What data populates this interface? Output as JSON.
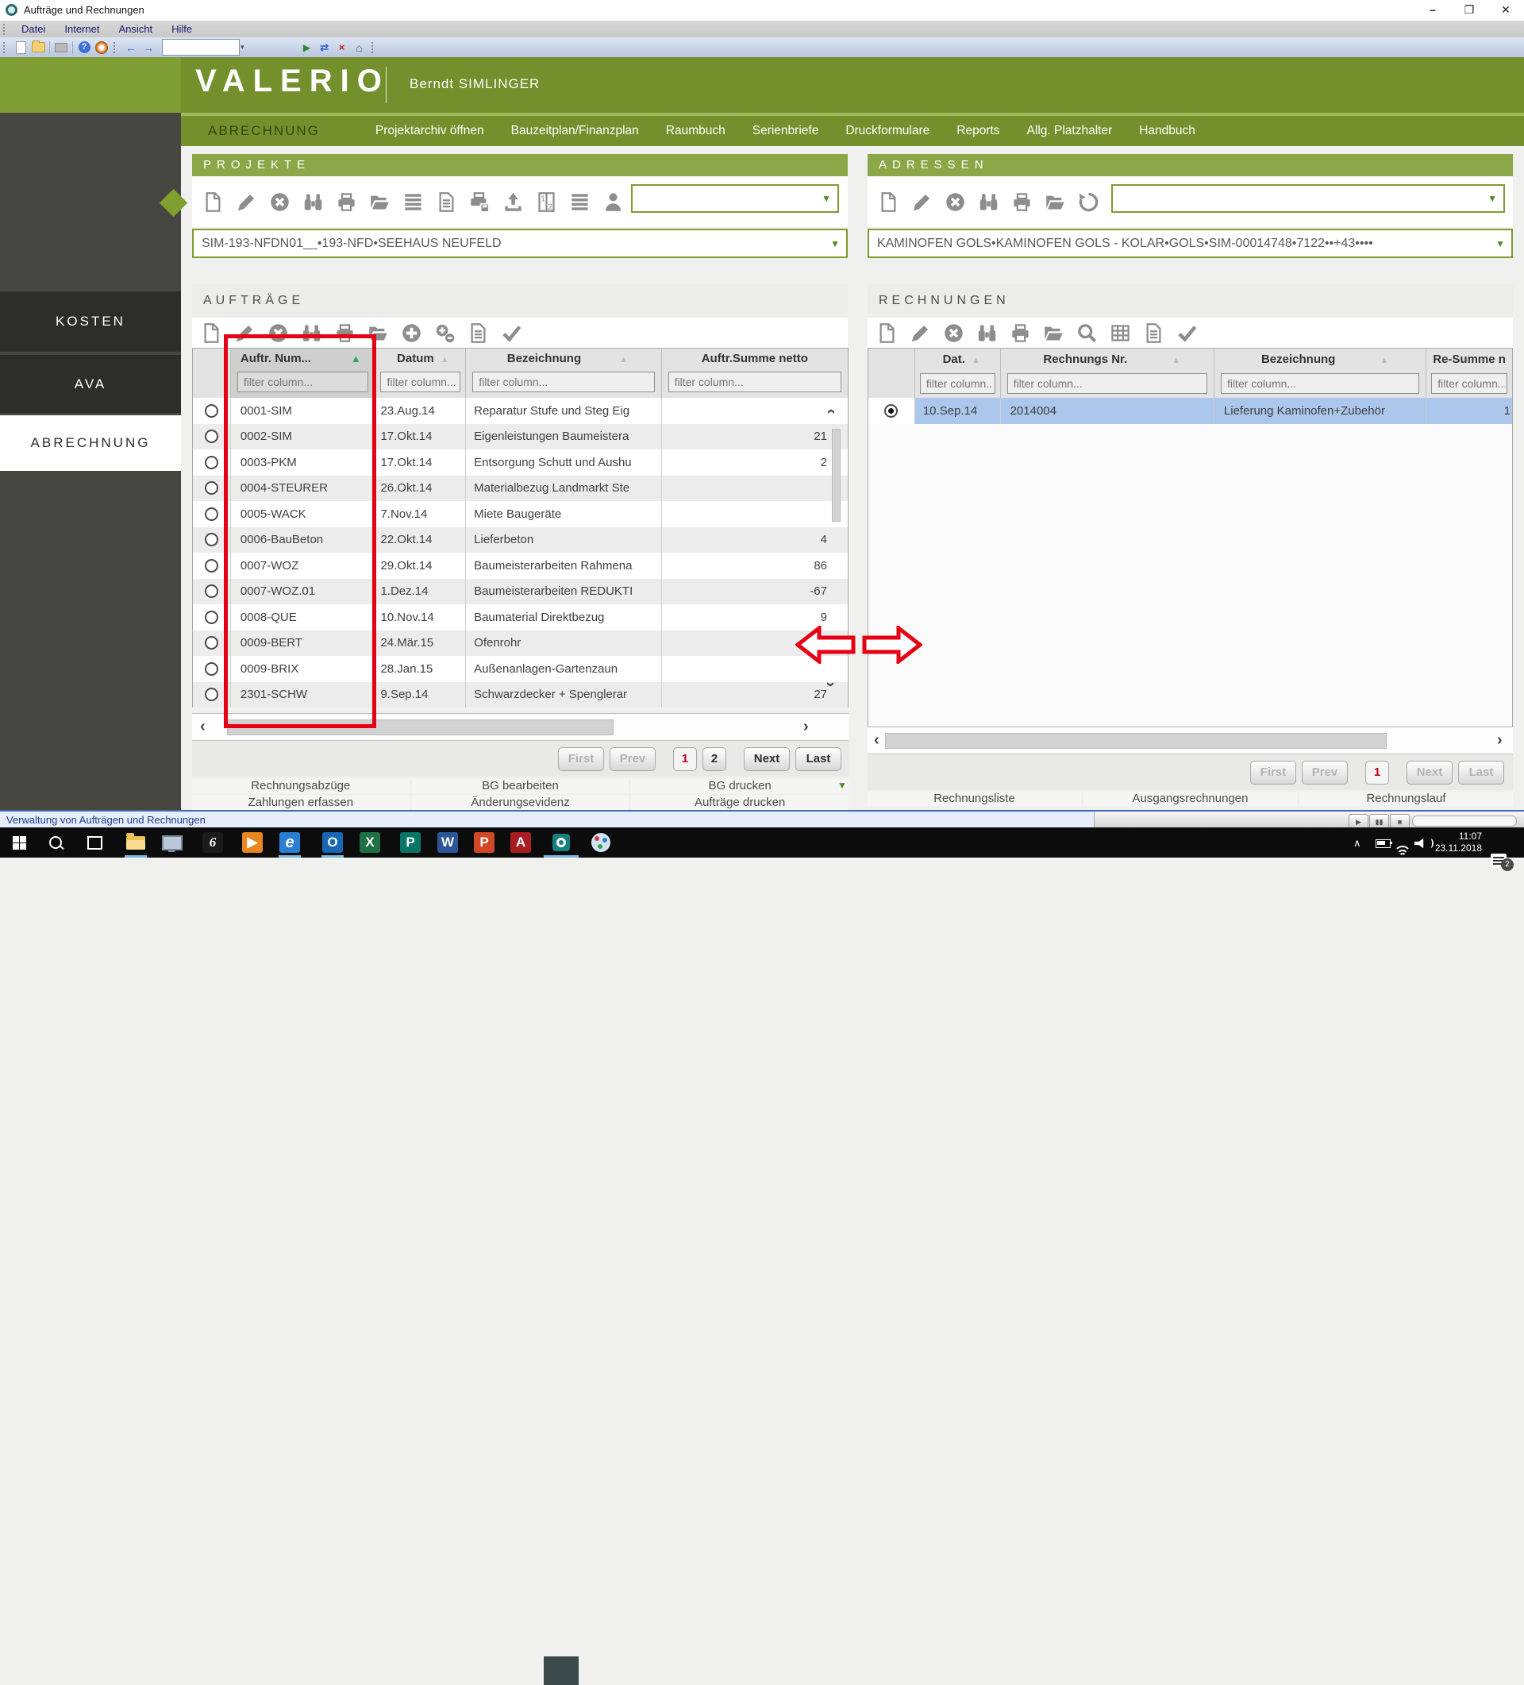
{
  "window": {
    "title": "Aufträge und Rechnungen"
  },
  "menubar": [
    "Datei",
    "Internet",
    "Ansicht",
    "Hilfe"
  ],
  "browser_toolbar": {
    "address_value": "",
    "icons": [
      "new-document-icon",
      "open-folder-icon",
      "print-icon",
      "help-icon",
      "sync-icon",
      "back-icon",
      "forward-icon",
      "go-icon",
      "refresh-icon",
      "stop-icon",
      "home-icon"
    ],
    "back_glyph": "←",
    "forward_glyph": "→",
    "go_glyph": "▶",
    "refresh_glyph": "⇄",
    "stop_glyph": "×",
    "home_glyph": "⌂"
  },
  "brand": {
    "logo": "VALERIO",
    "user": "Berndt SIMLINGER"
  },
  "nav": {
    "module": "ABRECHNUNG",
    "items": [
      "Projektarchiv öffnen",
      "Bauzeitplan/Finanzplan",
      "Raumbuch",
      "Serienbriefe",
      "Druckformulare",
      "Reports",
      "Allg. Platzhalter",
      "Handbuch"
    ]
  },
  "sidebar": {
    "items": [
      "KOSTEN",
      "AVA",
      "ABRECHNUNG"
    ],
    "active": "ABRECHNUNG"
  },
  "projekte": {
    "title": "PROJEKTE",
    "toolbar_icons": [
      "new-document-icon",
      "edit-icon",
      "delete-icon",
      "search-binoculars-icon",
      "print-icon",
      "folder-open-icon",
      "list-icon",
      "document-text-icon",
      "print-export-icon",
      "upload-icon",
      "pages-icon",
      "list-columns-icon",
      "user-icon"
    ],
    "search_value": "",
    "selected_project": "SIM-193-NFDN01__•193-NFD•SEEHAUS NEUFELD"
  },
  "adressen": {
    "title": "ADRESSEN",
    "toolbar_icons": [
      "new-document-icon",
      "edit-icon",
      "delete-icon",
      "search-binoculars-icon",
      "print-icon",
      "folder-open-icon",
      "history-icon"
    ],
    "search_value": "",
    "selected_address": "KAMINOFEN GOLS•KAMINOFEN GOLS - KOLAR•GOLS•SIM-00014748•7122••+43••••"
  },
  "auftraege": {
    "title": "AUFTRÄGE",
    "toolbar_icons": [
      "new-document-icon",
      "edit-icon",
      "delete-icon",
      "search-binoculars-icon",
      "print-icon",
      "folder-open-icon",
      "add-icon",
      "copy-add-icon",
      "document-text-icon",
      "check-icon"
    ],
    "columns": [
      {
        "label": "Auftr. Num...",
        "sort": "asc-active"
      },
      {
        "label": "Datum",
        "sort": "asc"
      },
      {
        "label": "Bezeichnung",
        "sort": "asc"
      },
      {
        "label": "Auftr.Summe netto",
        "sort": null
      }
    ],
    "filter_placeholder": "filter column...",
    "rows": [
      {
        "num": "0001-SIM",
        "datum": "23.Aug.14",
        "bezeichnung": "Reparatur Stufe und Steg Eig",
        "summe": ""
      },
      {
        "num": "0002-SIM",
        "datum": "17.Okt.14",
        "bezeichnung": "Eigenleistungen Baumeistera",
        "summe": "21"
      },
      {
        "num": "0003-PKM",
        "datum": "17.Okt.14",
        "bezeichnung": "Entsorgung Schutt und Aushu",
        "summe": "2"
      },
      {
        "num": "0004-STEURER",
        "datum": "26.Okt.14",
        "bezeichnung": "Materialbezug Landmarkt Ste",
        "summe": ""
      },
      {
        "num": "0005-WACK",
        "datum": "7.Nov.14",
        "bezeichnung": "Miete Baugeräte",
        "summe": ""
      },
      {
        "num": "0006-BauBeton",
        "datum": "22.Okt.14",
        "bezeichnung": "Lieferbeton",
        "summe": "4"
      },
      {
        "num": "0007-WOZ",
        "datum": "29.Okt.14",
        "bezeichnung": "Baumeisterarbeiten Rahmena",
        "summe": "86"
      },
      {
        "num": "0007-WOZ.01",
        "datum": "1.Dez.14",
        "bezeichnung": "Baumeisterarbeiten REDUKTI",
        "summe": "-67"
      },
      {
        "num": "0008-QUE",
        "datum": "10.Nov.14",
        "bezeichnung": "Baumaterial Direktbezug",
        "summe": "9"
      },
      {
        "num": "0009-BERT",
        "datum": "24.Mär.15",
        "bezeichnung": "Ofenrohr",
        "summe": ""
      },
      {
        "num": "0009-BRIX",
        "datum": "28.Jan.15",
        "bezeichnung": "Außenanlagen-Gartenzaun",
        "summe": ""
      },
      {
        "num": "2301-SCHW",
        "datum": "9.Sep.14",
        "bezeichnung": "Schwarzdecker + Spenglerar",
        "summe": "27"
      }
    ],
    "pagination": {
      "first": "First",
      "prev": "Prev",
      "page1": "1",
      "page2": "2",
      "next": "Next",
      "last": "Last",
      "current": "1"
    },
    "links_row1": [
      "Rechnungsabzüge",
      "BG bearbeiten",
      "BG drucken"
    ],
    "links_row2": [
      "Zahlungen erfassen",
      "Änderungsevidenz",
      "Aufträge drucken"
    ]
  },
  "rechnungen": {
    "title": "RECHNUNGEN",
    "toolbar_icons": [
      "new-document-icon",
      "edit-icon",
      "delete-icon",
      "search-binoculars-icon",
      "print-icon",
      "folder-open-icon",
      "zoom-icon",
      "table-icon",
      "document-text-icon",
      "check-icon"
    ],
    "columns": [
      {
        "label": "Dat.",
        "sort": "asc"
      },
      {
        "label": "Rechnungs Nr.",
        "sort": "asc"
      },
      {
        "label": "Bezeichnung",
        "sort": "asc"
      },
      {
        "label": "Re-Summe n",
        "sort": null
      }
    ],
    "filter_placeholder": "filter column...",
    "row": {
      "datum": "10.Sep.14",
      "nr": "2014004",
      "bezeichnung": "Lieferung Kaminofen+Zubehör",
      "summe": "1"
    },
    "pagination": {
      "first": "First",
      "prev": "Prev",
      "page1": "1",
      "next": "Next",
      "last": "Last",
      "current": "1"
    },
    "links": [
      "Rechnungsliste",
      "Ausgangsrechnungen",
      "Rechnungslauf"
    ]
  },
  "statusbar": {
    "text": "Verwaltung von Aufträgen und Rechnungen"
  },
  "taskbar": {
    "time": "11:07",
    "date": "23.11.2018",
    "notification_count": "2",
    "glyphs": {
      "ie": "e",
      "six": "6",
      "outlook": "O",
      "excel": "X",
      "publisher": "P",
      "word": "W",
      "powerpoint": "P",
      "adobe": "A"
    }
  },
  "colors": {
    "olive": "#74902c",
    "olive_light": "#7e9d33",
    "panel_green": "#8ba747",
    "sidebar": "#474742",
    "selection_blue": "#abc7ec",
    "annotation_red": "#e60014"
  }
}
